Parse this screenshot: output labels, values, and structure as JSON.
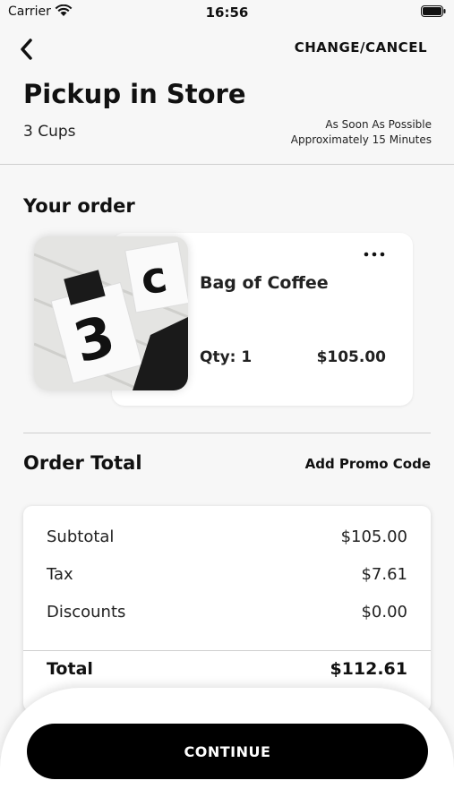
{
  "status_bar": {
    "carrier": "Carrier",
    "time": "16:56"
  },
  "header": {
    "back_icon": "chevron-left-icon",
    "action_label": "CHANGE/CANCEL",
    "title": "Pickup in Store",
    "subtitle": "3 Cups",
    "eta_line1": "As Soon As Possible",
    "eta_line2": "Approximately 15 Minutes"
  },
  "order": {
    "section_title": "Your order",
    "items": [
      {
        "name": "Bag of Coffee",
        "qty_label": "Qty: 1",
        "price": "$105.00",
        "more_icon": "more-horizontal-icon"
      }
    ]
  },
  "totals": {
    "section_title": "Order Total",
    "promo_label": "Add Promo Code",
    "rows": [
      {
        "label": "Subtotal",
        "value": "$105.00"
      },
      {
        "label": "Tax",
        "value": "$7.61"
      },
      {
        "label": "Discounts",
        "value": "$0.00"
      }
    ],
    "total_label": "Total",
    "total_value": "$112.61"
  },
  "footer": {
    "continue_label": "CONTINUE"
  },
  "colors": {
    "background": "#f7f7f7",
    "card": "#ffffff",
    "primary_button": "#000000",
    "text": "#111111"
  }
}
